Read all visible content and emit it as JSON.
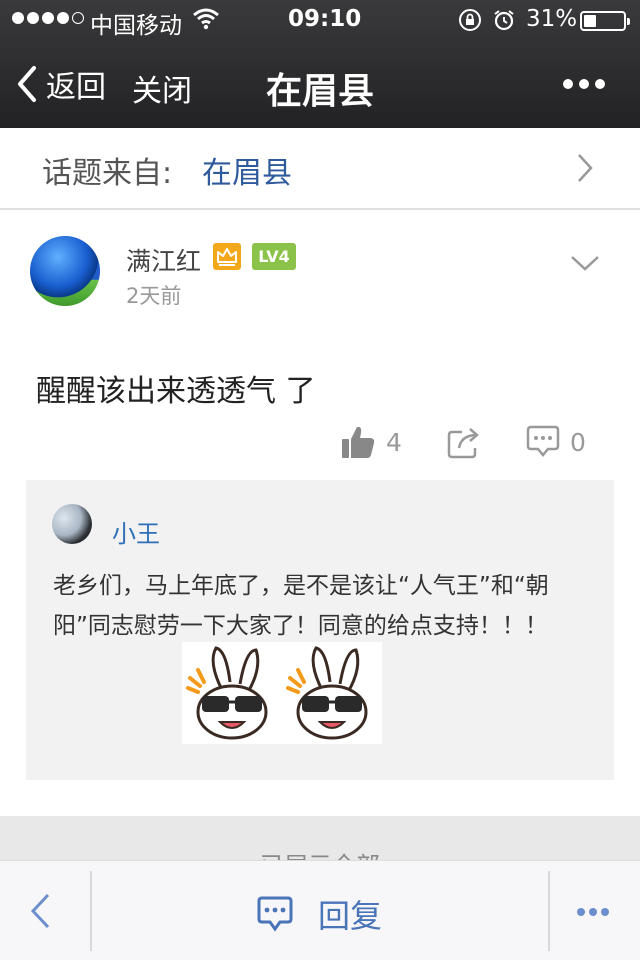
{
  "status_bar": {
    "carrier": "中国移动",
    "time": "09:10",
    "battery_percent": "31%",
    "battery_level": 0.31
  },
  "nav": {
    "back_label": "返回",
    "close_label": "关闭",
    "title": "在眉县"
  },
  "topic": {
    "prefix": "话题来自:",
    "name": "在眉县"
  },
  "post": {
    "author": "满江红",
    "level_badge": "LV4",
    "time_ago": "2天前",
    "content": "醒醒该出来透透气 了",
    "like_count": "4",
    "comment_count": "0"
  },
  "reply": {
    "author": "小王",
    "text": "老乡们，马上年底了，是不是该让“人气王”和“朝阳”同志慰劳一下大家了！同意的给点支持！！！"
  },
  "show_all_label": "已展示全部",
  "toolbar": {
    "reply_label": "回复"
  },
  "colors": {
    "link_blue": "#2f5a9c",
    "badge_gold": "#f3a81b",
    "badge_green": "#8bc34a",
    "toolbar_blue": "#4a74b8"
  }
}
